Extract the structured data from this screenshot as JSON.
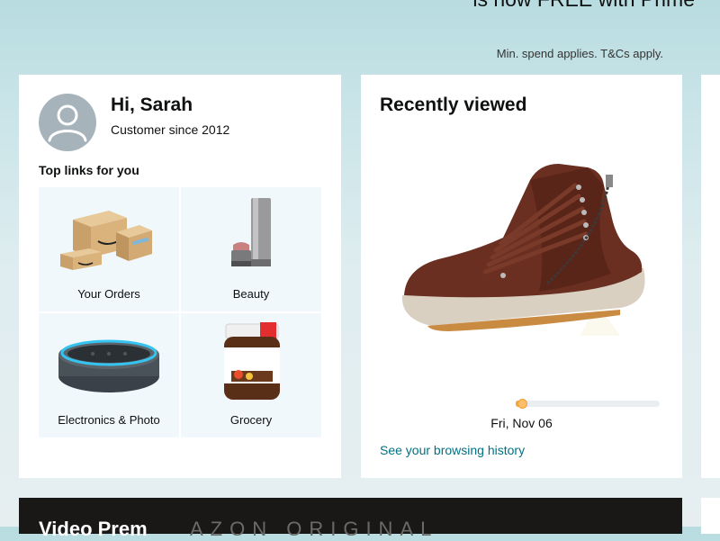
{
  "hero": {
    "title": "is now FREE with Prime",
    "note": "Min. spend applies. T&Cs apply."
  },
  "account": {
    "greeting": "Hi, Sarah",
    "since": "Customer since 2012",
    "top_links_heading": "Top links for you",
    "tiles": [
      {
        "label": "Your Orders",
        "icon": "boxes-icon"
      },
      {
        "label": "Beauty",
        "icon": "lipstick-icon"
      },
      {
        "label": "Electronics & Photo",
        "icon": "smart-speaker-icon"
      },
      {
        "label": "Grocery",
        "icon": "spread-jar-icon"
      }
    ]
  },
  "recently_viewed": {
    "title": "Recently viewed",
    "product_icon": "ankle-boot-icon",
    "date": "Fri, Nov 06",
    "carousel_progress": 0.03,
    "history_link": "See your browsing history"
  },
  "promo": {
    "title": "Video Prem",
    "subtitle": "AZON ORIGINAL"
  },
  "colors": {
    "link": "#007185",
    "progress": "#f3a847",
    "tile_bg": "#f0f8fb"
  }
}
